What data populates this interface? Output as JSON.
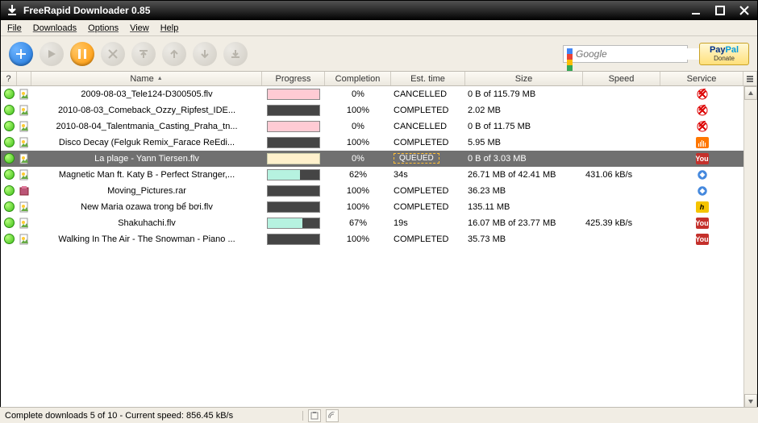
{
  "window": {
    "title": "FreeRapid Downloader 0.85"
  },
  "menu": {
    "file": "File",
    "downloads": "Downloads",
    "options": "Options",
    "view": "View",
    "help": "Help"
  },
  "search": {
    "placeholder": "Google"
  },
  "paypal": {
    "brand_pay": "Pay",
    "brand_pal": "Pal",
    "donate": "Donate"
  },
  "headers": {
    "q": "?",
    "name": "Name",
    "progress": "Progress",
    "completion": "Completion",
    "est": "Est. time",
    "size": "Size",
    "speed": "Speed",
    "service": "Service"
  },
  "rows": [
    {
      "name": "2009-08-03_Tele124-D300505.flv",
      "progress_type": "cancelled",
      "progress_pct": 0,
      "completion": "0%",
      "est": "CANCELLED",
      "size": "0 B of 115.79 MB",
      "speed": "",
      "service": "megaupload",
      "selected": false
    },
    {
      "name": "2010-08-03_Comeback_Ozzy_Ripfest_IDE...",
      "progress_type": "complete",
      "progress_pct": 100,
      "completion": "100%",
      "est": "COMPLETED",
      "size": "2.02 MB",
      "speed": "",
      "service": "megaupload",
      "selected": false
    },
    {
      "name": "2010-08-04_Talentmania_Casting_Praha_tn...",
      "progress_type": "cancelled",
      "progress_pct": 0,
      "completion": "0%",
      "est": "CANCELLED",
      "size": "0 B of 11.75 MB",
      "speed": "",
      "service": "megaupload",
      "selected": false
    },
    {
      "name": "Disco Decay (Felguk Remix_Farace ReEdi...",
      "progress_type": "complete",
      "progress_pct": 100,
      "completion": "100%",
      "est": "COMPLETED",
      "size": "5.95 MB",
      "speed": "",
      "service": "soundcloud",
      "selected": false
    },
    {
      "name": "La plage - Yann Tiersen.flv",
      "progress_type": "queued",
      "progress_pct": 0,
      "completion": "0%",
      "est": "QUEUED",
      "size": "0 B of 3.03 MB",
      "speed": "",
      "service": "youtube",
      "selected": true
    },
    {
      "name": "Magnetic Man ft. Katy B - Perfect Stranger,...",
      "progress_type": "partial",
      "progress_pct": 62,
      "completion": "62%",
      "est": "34s",
      "size": "26.71 MB of 42.41 MB",
      "speed": "431.06 kB/s",
      "service": "generic",
      "selected": false
    },
    {
      "name": "Moving_Pictures.rar",
      "progress_type": "complete",
      "progress_pct": 100,
      "completion": "100%",
      "est": "COMPLETED",
      "size": "36.23 MB",
      "speed": "",
      "service": "generic",
      "icon": "rar",
      "selected": false
    },
    {
      "name": "New Maria ozawa trong bể bơi.flv",
      "progress_type": "complete",
      "progress_pct": 100,
      "completion": "100%",
      "est": "COMPLETED",
      "size": "135.11 MB",
      "speed": "",
      "service": "hotfile",
      "selected": false
    },
    {
      "name": "Shakuhachi.flv",
      "progress_type": "partial",
      "progress_pct": 67,
      "completion": "67%",
      "est": "19s",
      "size": "16.07 MB of 23.77 MB",
      "speed": "425.39 kB/s",
      "service": "youtube",
      "selected": false
    },
    {
      "name": "Walking In The Air - The Snowman - Piano ...",
      "progress_type": "complete",
      "progress_pct": 100,
      "completion": "100%",
      "est": "COMPLETED",
      "size": "35.73 MB",
      "speed": "",
      "service": "youtube",
      "selected": false
    }
  ],
  "statusbar": {
    "text": "Complete downloads 5 of 10 - Current speed: 856.45 kB/s"
  }
}
